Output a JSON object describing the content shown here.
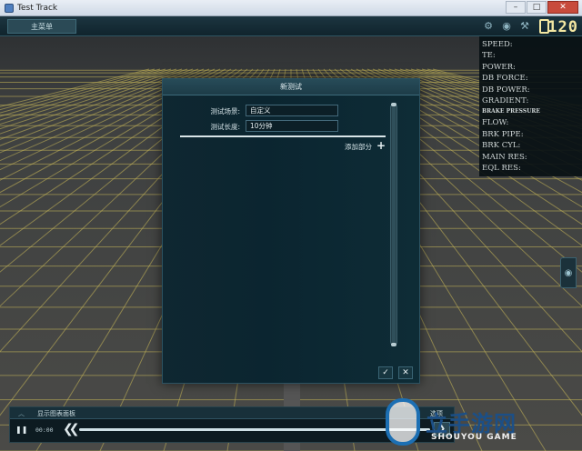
{
  "window": {
    "title": "Test Track",
    "minimize_glyph": "–",
    "maximize_glyph": "□",
    "close_glyph": "✕"
  },
  "toolbar": {
    "main_menu_label": "主菜单",
    "icons": [
      "settings-icon",
      "eye-icon",
      "tools-icon",
      "battery-icon"
    ],
    "speed": "120"
  },
  "telemetry": {
    "rows": [
      "SPEED:",
      "TE:",
      "POWER:",
      "DB FORCE:",
      "DB POWER:",
      "GRADIENT:",
      "BRAKE PRESSURE",
      "FLOW:",
      "BRK PIPE:",
      "BRK CYL:",
      "MAIN RES:",
      "EQL RES:"
    ]
  },
  "dialog": {
    "title": "新测试",
    "fields": [
      {
        "label": "测试场景:",
        "value": "自定义"
      },
      {
        "label": "测试长度:",
        "value": "10分钟"
      }
    ],
    "add_section_label": "添加部分",
    "add_glyph": "+",
    "confirm_glyph": "✓",
    "cancel_glyph": "✕"
  },
  "bottom_panel": {
    "collapse_glyph": "︿",
    "title": "显示图表面板",
    "right_label": "选项",
    "pause_glyph": "❚❚",
    "time": "00:00",
    "rewind_glyph": "❮❮",
    "forward_glyph": "❯"
  },
  "watermark": {
    "text": "立手游网",
    "sub": "SHOUYOU GAME"
  },
  "colors": {
    "accent": "#1d3c48",
    "grid_line": "#c9b85a",
    "speed_readout": "#f3e7a2"
  }
}
